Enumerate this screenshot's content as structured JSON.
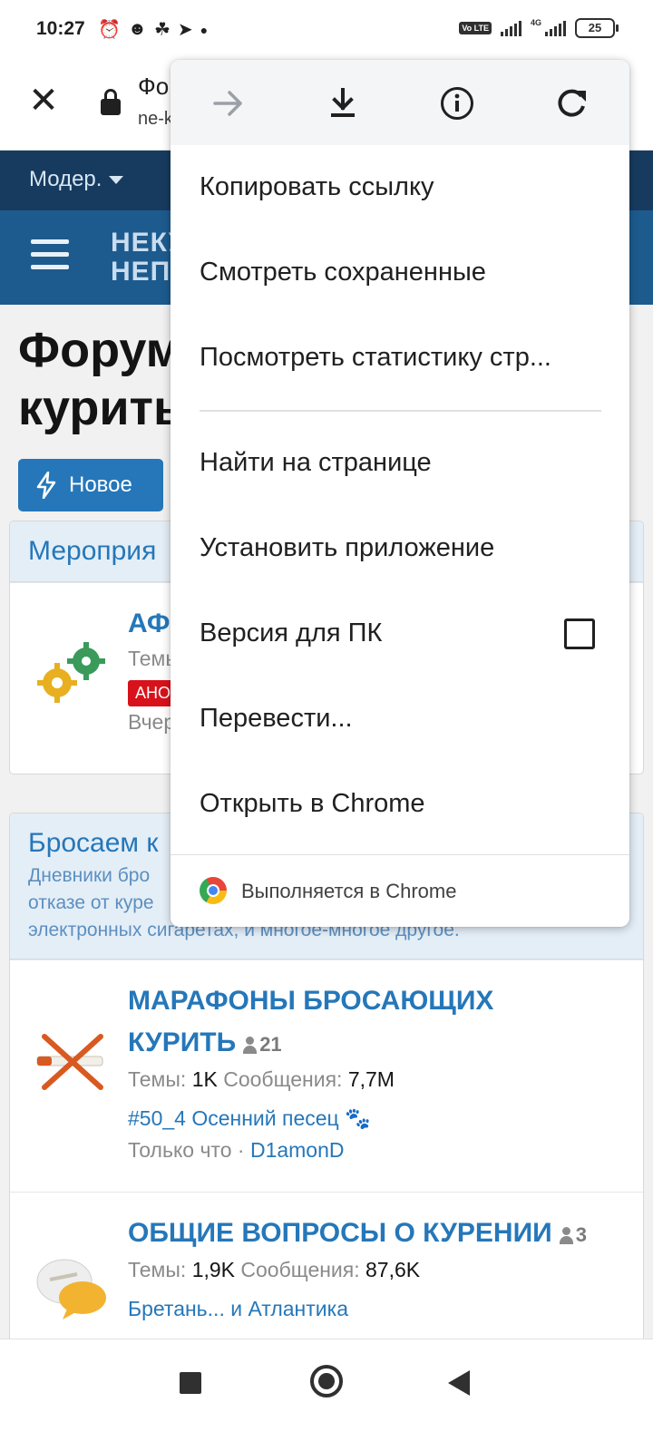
{
  "status_bar": {
    "time": "10:27",
    "battery": "25",
    "network_label": "4G",
    "volte": "Vo LTE"
  },
  "browser": {
    "title": "Фо",
    "url": "ne-k"
  },
  "forum": {
    "nav_label": "Модер.",
    "logo_line1": "НЕКУ",
    "logo_line2": "НЕП",
    "page_title_line1": "Форум",
    "page_title_line2": "курить",
    "new_button": "Новое",
    "sections": [
      {
        "title": "Мероприя",
        "node": {
          "title": "АФ",
          "stats_label": "Темы",
          "badge": "АНО",
          "time": "Вчер"
        }
      },
      {
        "title": "Бросаем к",
        "desc_line1": "Дневники бро",
        "desc_line2": "отказе от куре",
        "desc_line3": "электронных сигаретах, и многое-многое другое.",
        "nodes": [
          {
            "title_line1": "МАРАФОНЫ БРОСАЮЩИХ",
            "title_line2": "КУРИТЬ",
            "users": "21",
            "threads_label": "Темы:",
            "threads": "1K",
            "messages_label": "Сообщения:",
            "messages": "7,7M",
            "last_post": "#50_4 Осенний песец 🐾",
            "time": "Только что",
            "separator": "·",
            "user": "D1amonD"
          },
          {
            "title_line1": "ОБЩИЕ ВОПРОСЫ О КУРЕНИИ",
            "users": "3",
            "threads_label": "Темы:",
            "threads": "1,9K",
            "messages_label": "Сообщения:",
            "messages": "87,6K",
            "last_post": "Бретань... и Атлантика"
          }
        ]
      }
    ]
  },
  "menu": {
    "toolbar_icons": [
      "forward-icon",
      "download-icon",
      "info-icon",
      "refresh-icon"
    ],
    "items": [
      "Копировать ссылку",
      "Смотреть сохраненные",
      "Посмотреть статистику стр...",
      "Найти на странице",
      "Установить приложение",
      "Версия для ПК",
      "Перевести...",
      "Открыть в Chrome"
    ],
    "desktop_checked": false,
    "footer": "Выполняется в Chrome"
  },
  "colors": {
    "accent": "#2577b9",
    "nav_dark": "#173b5f",
    "header": "#1d5b8e",
    "badge": "#d8121b"
  }
}
